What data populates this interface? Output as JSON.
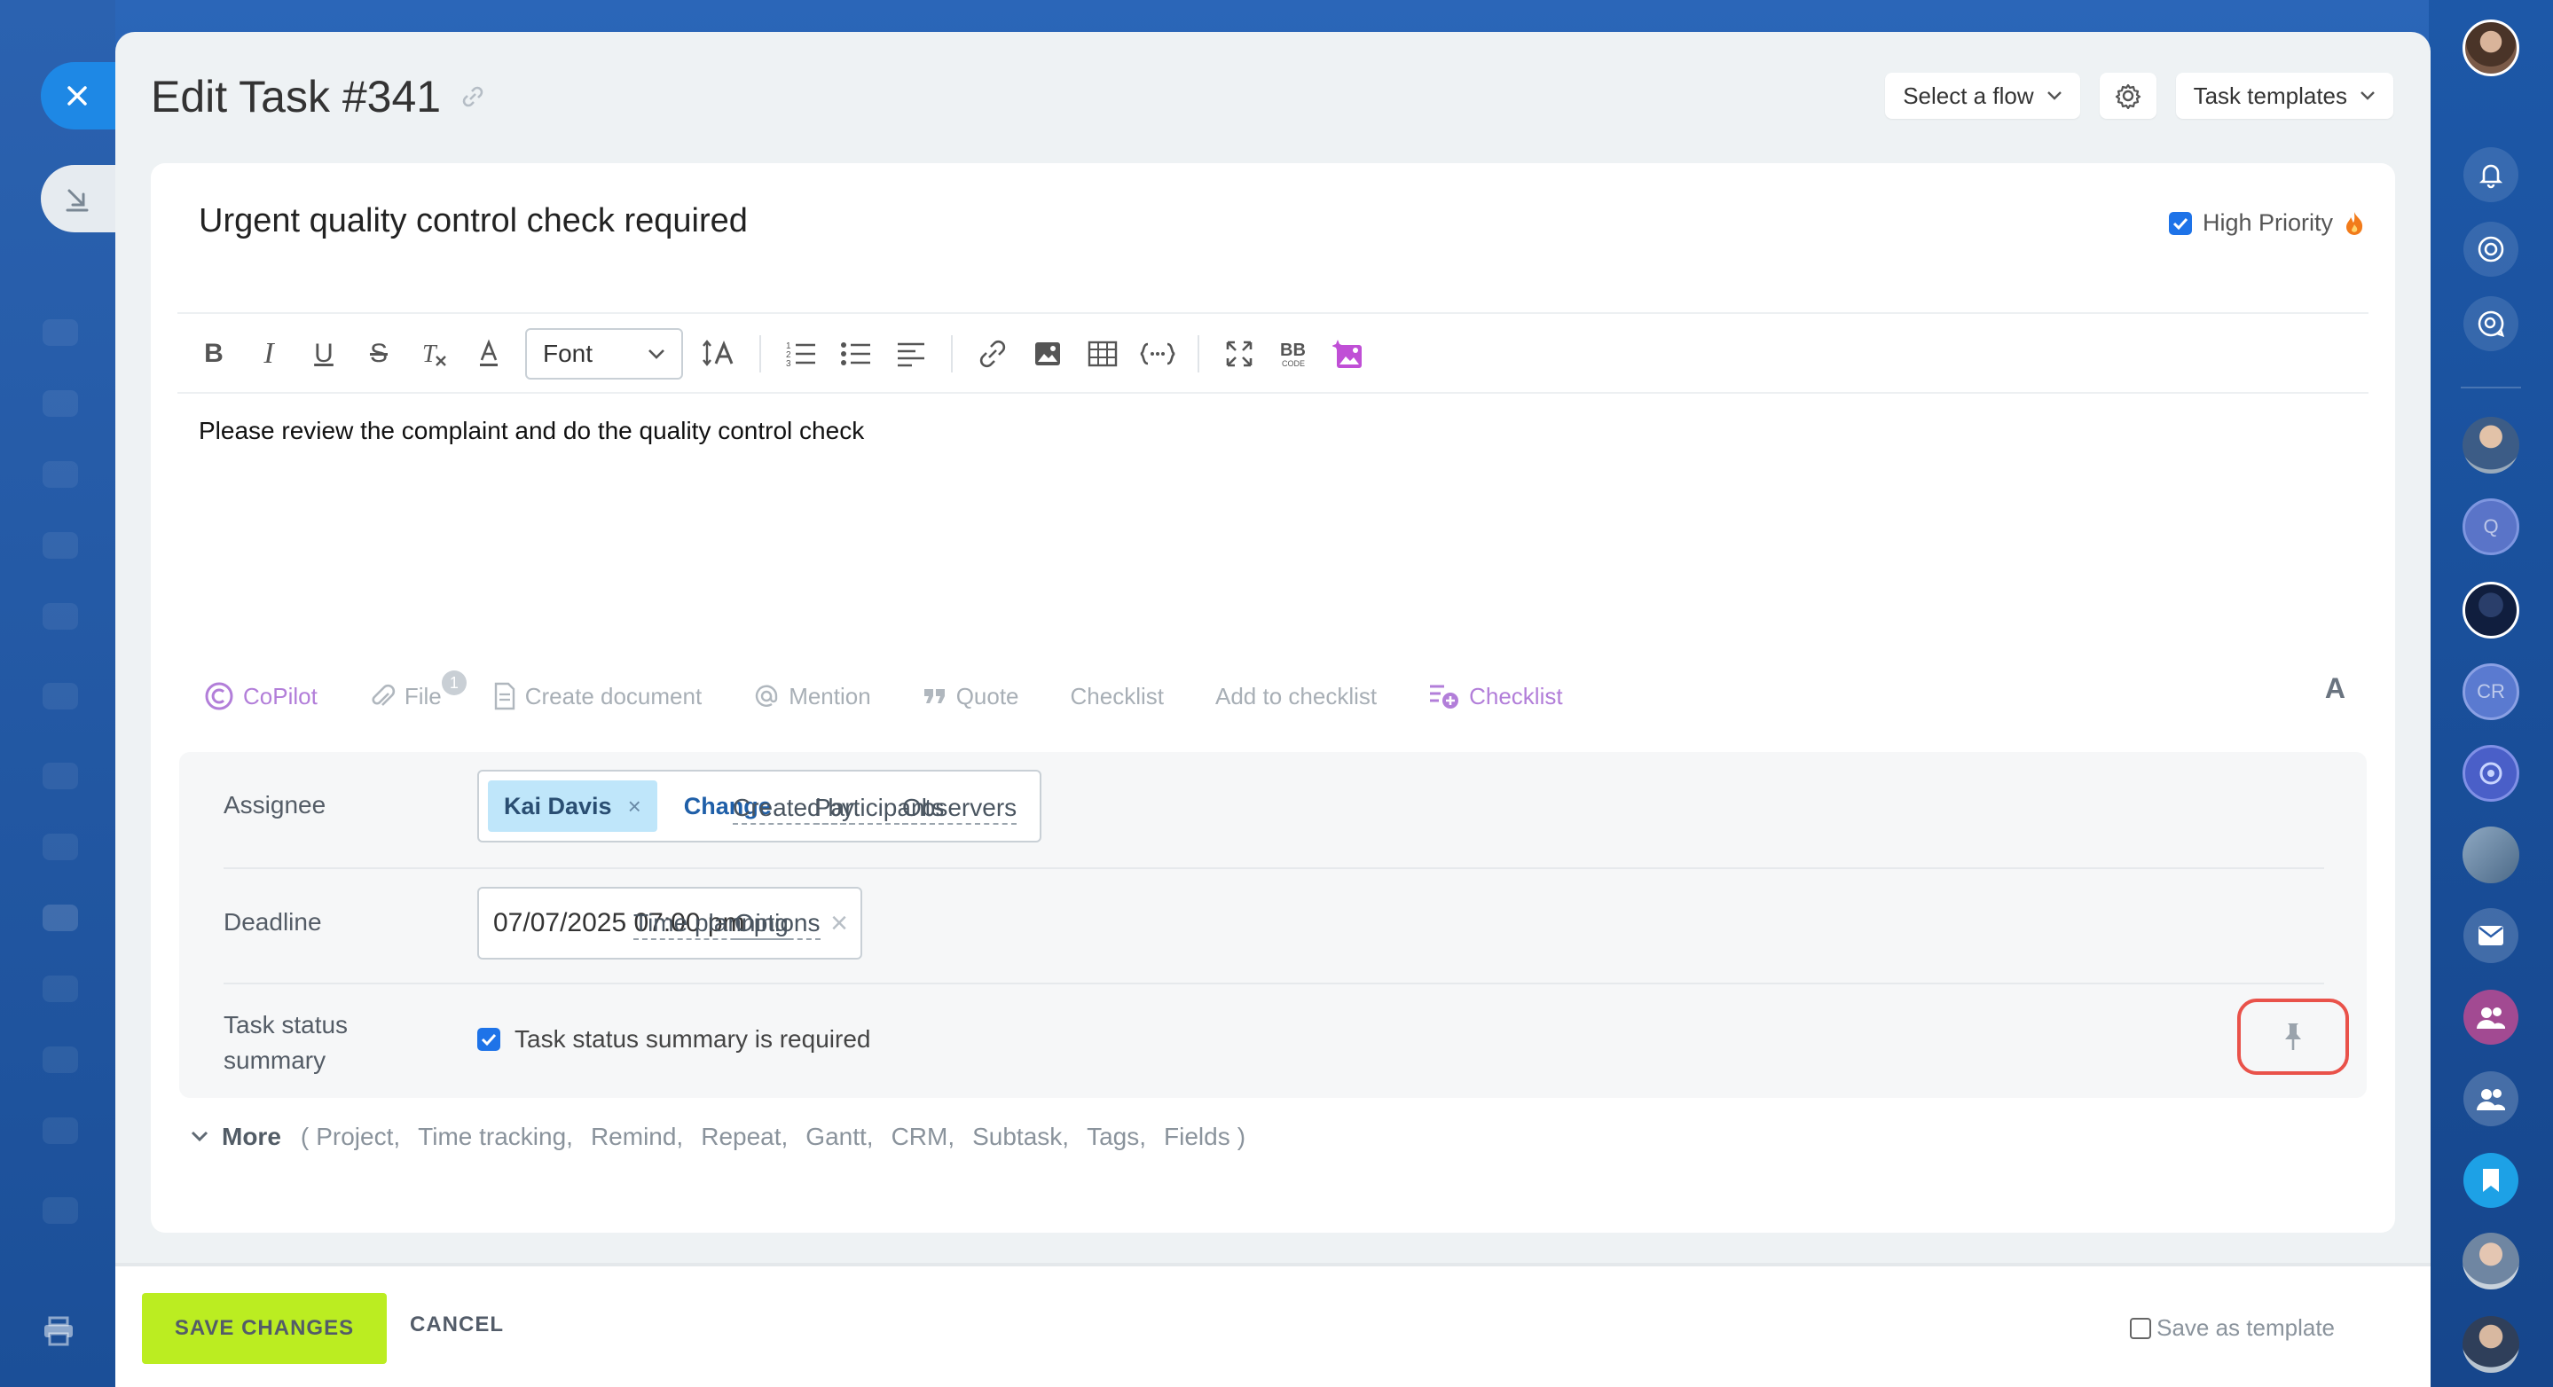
{
  "header": {
    "title": "Edit Task #341",
    "select_flow": "Select a flow",
    "task_templates": "Task templates"
  },
  "task": {
    "title": "Urgent quality control check required",
    "high_priority_label": "High Priority",
    "high_priority_checked": true,
    "description": "Please review the complaint and do the quality control check"
  },
  "toolbar": {
    "font_label": "Font",
    "icons": [
      "bold-icon",
      "italic-icon",
      "underline-icon",
      "strikethrough-icon",
      "clear-format-icon",
      "text-color-icon",
      "font-size-icon",
      "numbered-list-icon",
      "bullet-list-icon",
      "align-icon",
      "link-icon",
      "image-icon",
      "table-icon",
      "code-icon",
      "fullscreen-icon",
      "bbcode-icon",
      "ai-image-icon"
    ]
  },
  "actions": {
    "copilot": "CoPilot",
    "file": "File",
    "file_count": "1",
    "create_document": "Create document",
    "mention": "Mention",
    "quote": "Quote",
    "checklist": "Checklist",
    "add_to_checklist": "Add to checklist",
    "checklist2": "Checklist",
    "font_toggle": "A"
  },
  "fields": {
    "assignee_label": "Assignee",
    "assignee_name": "Kai Davis",
    "assignee_remove": "×",
    "change": "Change",
    "created_by": "Created by",
    "participants": "Participants",
    "observers": "Observers",
    "deadline_label": "Deadline",
    "deadline_value": "07/07/2025 07:00 pm",
    "deadline_clear": "×",
    "time_planning": "Time planning",
    "options": "Options",
    "summary_label_1": "Task status",
    "summary_label_2": "summary",
    "summary_check_label": "Task status summary is required",
    "summary_checked": true
  },
  "more": {
    "label": "More",
    "open_paren": "(",
    "items": [
      "Project,",
      "Time tracking,",
      "Remind,",
      "Repeat,",
      "Gantt,",
      "CRM,",
      "Subtask,",
      "Tags,",
      "Fields"
    ],
    "close_paren": ")"
  },
  "footer": {
    "save": "SAVE CHANGES",
    "cancel": "CANCEL",
    "save_template": "Save as template"
  },
  "right_rail": {
    "q_label": "Q",
    "cr_label": "CR"
  },
  "colors": {
    "accent_blue": "#1e73e8",
    "save_green": "#bbed21",
    "copilot_purple": "#b27ed9",
    "highlight_red": "#e9524a",
    "chip_blue": "#bfe6fa"
  }
}
